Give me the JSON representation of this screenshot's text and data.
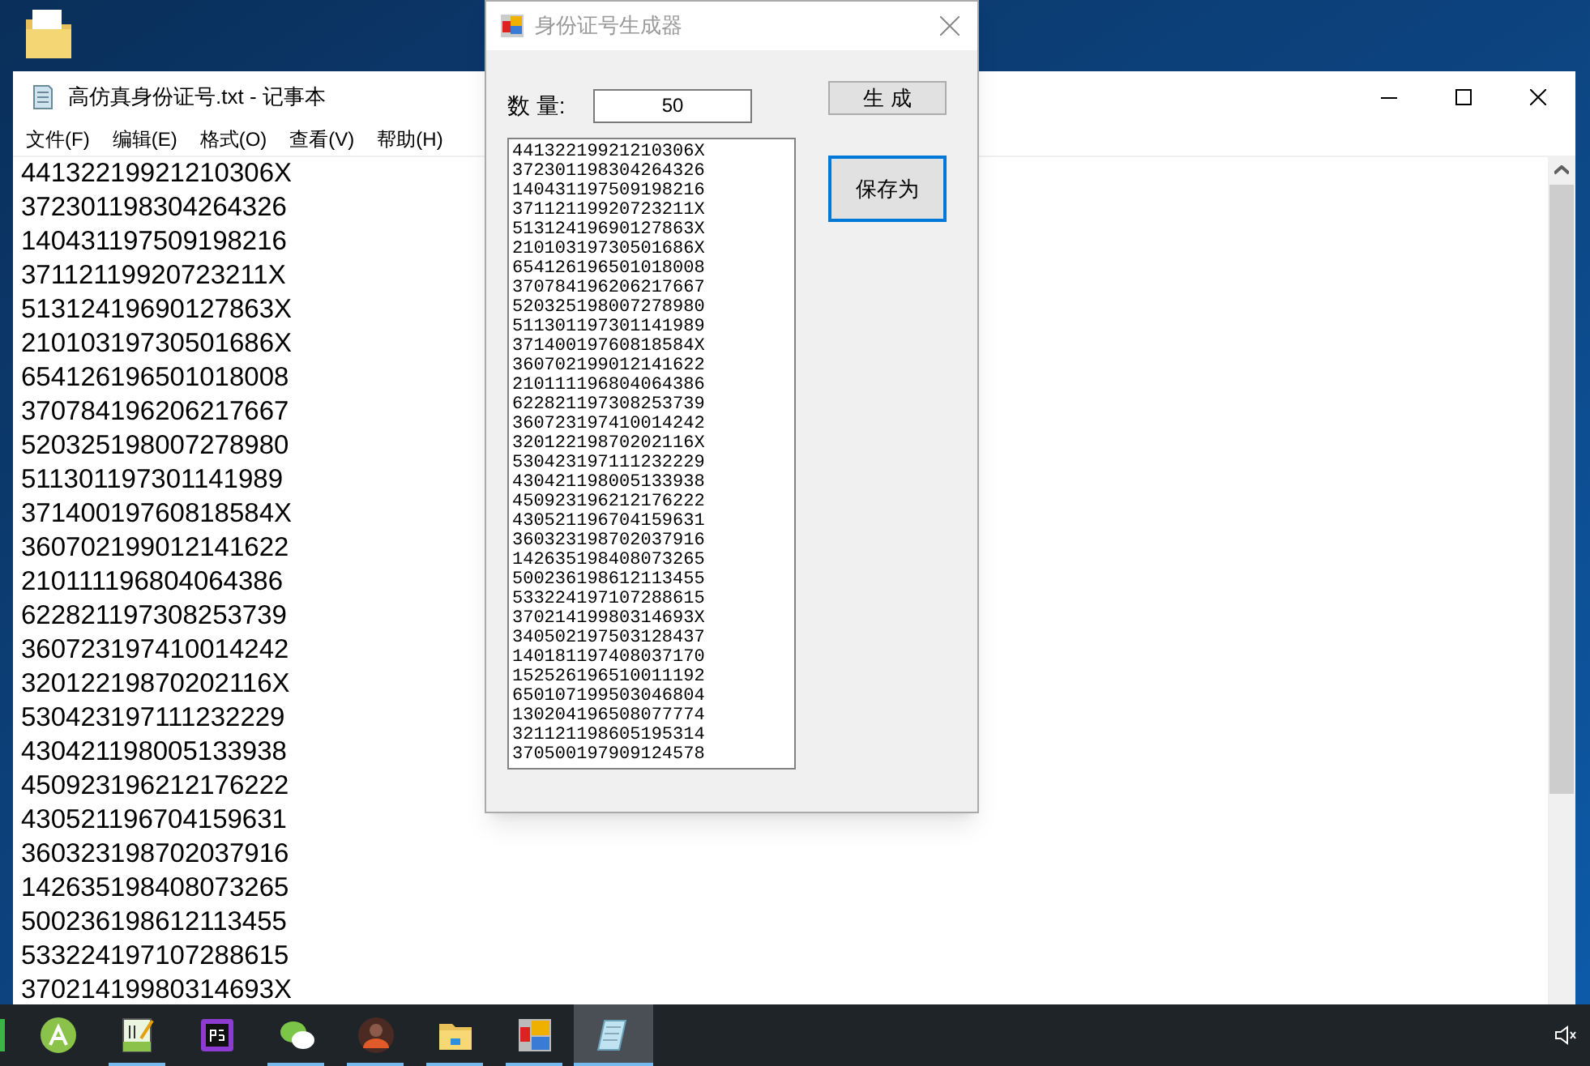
{
  "notepad": {
    "title": "高仿真身份证号.txt - 记事本",
    "menu": [
      "文件(F)",
      "编辑(E)",
      "格式(O)",
      "查看(V)",
      "帮助(H)"
    ],
    "lines": [
      "44132219921210306X",
      "372301198304264326",
      "140431197509198216",
      "37112119920723211X",
      "51312419690127863X",
      "21010319730501686X",
      "654126196501018008",
      "370784196206217667",
      "520325198007278980",
      "511301197301141989",
      "37140019760818584X",
      "360702199012141622",
      "210111196804064386",
      "622821197308253739",
      "360723197410014242",
      "32012219870202116X",
      "530423197111232229",
      "430421198005133938",
      "450923196212176222",
      "430521196704159631",
      "360323198702037916",
      "142635198408073265",
      "500236198612113455",
      "533224197107288615",
      "37021419980314693X"
    ]
  },
  "dialog": {
    "title": "身份证号生成器",
    "count_label": "数 量:",
    "count_value": "50",
    "generate_button": "生 成",
    "save_button": "保存为",
    "list": [
      "44132219921210306X",
      "372301198304264326",
      "140431197509198216",
      "37112119920723211X",
      "51312419690127863X",
      "21010319730501686X",
      "654126196501018008",
      "370784196206217667",
      "520325198007278980",
      "511301197301141989",
      "37140019760818584X",
      "360702199012141622",
      "210111196804064386",
      "622821197308253739",
      "360723197410014242",
      "32012219870202116X",
      "530423197111232229",
      "430421198005133938",
      "450923196212176222",
      "430521196704159631",
      "360323198702037916",
      "142635198408073265",
      "500236198612113455",
      "533224197107288615",
      "37021419980314693X",
      "340502197503128437",
      "140181197408037170",
      "152526196510011192",
      "650107199503046804",
      "130204196508077774",
      "321121198605195314",
      "370500197909124578"
    ]
  },
  "taskbar": {
    "items": [
      {
        "kind": "android",
        "running": false,
        "selected": false
      },
      {
        "kind": "editor",
        "running": true,
        "selected": false
      },
      {
        "kind": "ps",
        "running": false,
        "selected": false
      },
      {
        "kind": "chat",
        "running": true,
        "selected": false
      },
      {
        "kind": "avatar",
        "running": true,
        "selected": false
      },
      {
        "kind": "folder",
        "running": true,
        "selected": false
      },
      {
        "kind": "app",
        "running": true,
        "selected": false
      },
      {
        "kind": "notepad",
        "running": true,
        "selected": true
      }
    ]
  }
}
